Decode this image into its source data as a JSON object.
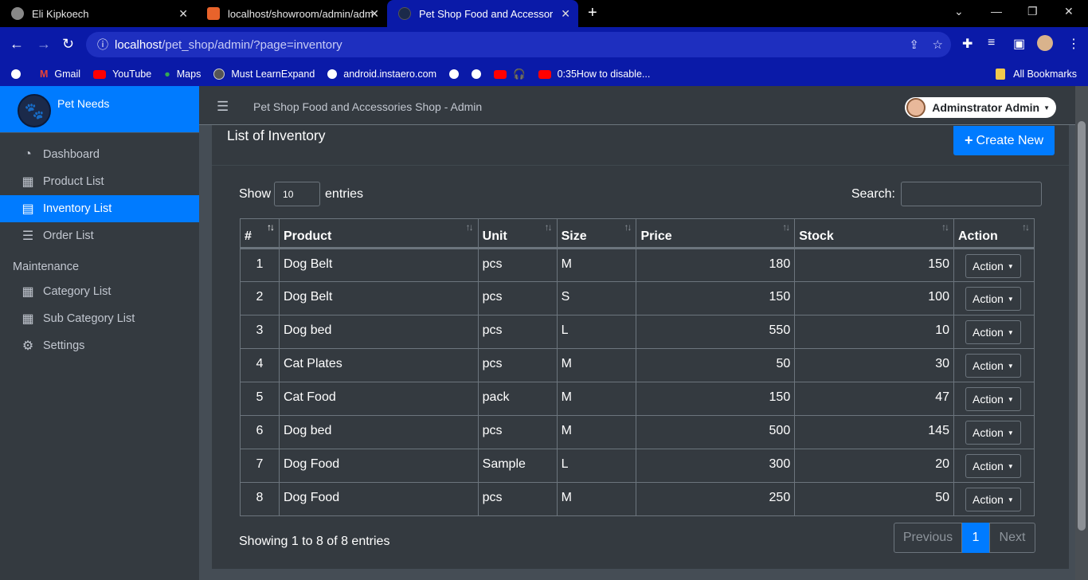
{
  "browser": {
    "tabs": [
      {
        "title": "Eli Kipkoech"
      },
      {
        "title": "localhost/showroom/admin/adm"
      },
      {
        "title": "Pet Shop Food and Accessories S"
      }
    ],
    "url_host": "localhost",
    "url_path": "/pet_shop/admin/?page=inventory",
    "bookmarks": [
      "Gmail",
      "YouTube",
      "Maps",
      "Must LearnExpand",
      "android.instaero.com",
      "",
      "",
      "0:35How to disable..."
    ],
    "all_bookmarks": "All Bookmarks"
  },
  "sidebar": {
    "brand": "Pet Needs",
    "items": [
      {
        "label": "Dashboard",
        "icon": "dashboard-icon"
      },
      {
        "label": "Product List",
        "icon": "box-icon"
      },
      {
        "label": "Inventory List",
        "icon": "clipboard-icon"
      },
      {
        "label": "Order List",
        "icon": "list-icon"
      }
    ],
    "section": "Maintenance",
    "maintenance_items": [
      {
        "label": "Category List",
        "icon": "table-icon"
      },
      {
        "label": "Sub Category List",
        "icon": "table-icon"
      },
      {
        "label": "Settings",
        "icon": "cogs-icon"
      }
    ]
  },
  "header": {
    "app_title": "Pet Shop Food and Accessories Shop - Admin",
    "user": "Adminstrator Admin"
  },
  "page": {
    "title": "List of Inventory",
    "create_label": "Create New",
    "show_label": "Show",
    "entries_value": "10",
    "entries_label": "entries",
    "search_label": "Search:",
    "info": "Showing 1 to 8 of 8 entries",
    "prev": "Previous",
    "current_page": "1",
    "next": "Next"
  },
  "table": {
    "headers": [
      "#",
      "Product",
      "Unit",
      "Size",
      "Price",
      "Stock",
      "Action"
    ],
    "action_label": "Action",
    "rows": [
      {
        "no": "1",
        "product": "Dog Belt",
        "unit": "pcs",
        "size": "M",
        "price": "180",
        "stock": "150"
      },
      {
        "no": "2",
        "product": "Dog Belt",
        "unit": "pcs",
        "size": "S",
        "price": "150",
        "stock": "100"
      },
      {
        "no": "3",
        "product": "Dog bed",
        "unit": "pcs",
        "size": "L",
        "price": "550",
        "stock": "10"
      },
      {
        "no": "4",
        "product": "Cat Plates",
        "unit": "pcs",
        "size": "M",
        "price": "50",
        "stock": "30"
      },
      {
        "no": "5",
        "product": "Cat Food",
        "unit": "pack",
        "size": "M",
        "price": "150",
        "stock": "47"
      },
      {
        "no": "6",
        "product": "Dog bed",
        "unit": "pcs",
        "size": "M",
        "price": "500",
        "stock": "145"
      },
      {
        "no": "7",
        "product": "Dog Food",
        "unit": "Sample",
        "size": "L",
        "price": "300",
        "stock": "20"
      },
      {
        "no": "8",
        "product": "Dog Food",
        "unit": "pcs",
        "size": "M",
        "price": "250",
        "stock": "50"
      }
    ]
  }
}
